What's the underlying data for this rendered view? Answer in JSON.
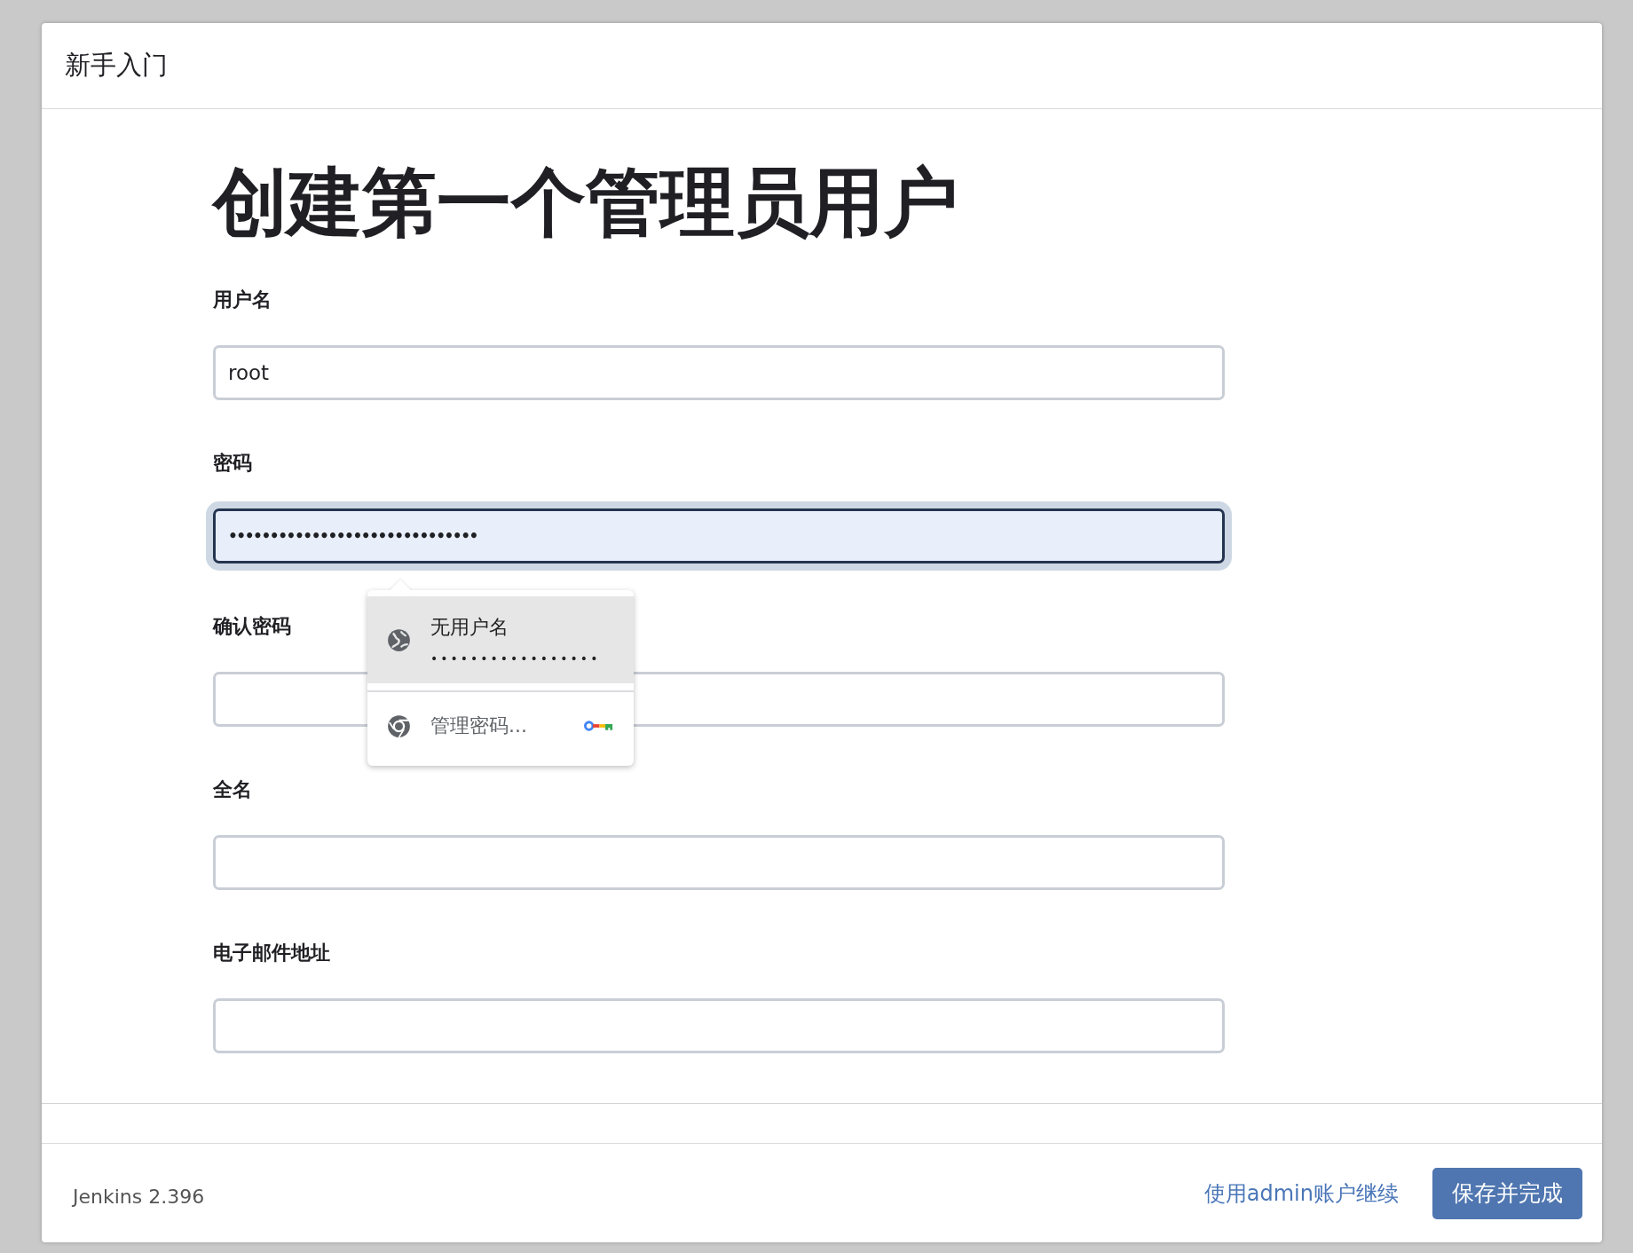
{
  "dialog": {
    "title": "新手入门"
  },
  "heading": "创建第一个管理员用户",
  "fields": [
    {
      "label": "用户名",
      "value": "root",
      "focused": false
    },
    {
      "label": "密码",
      "value": "••••••••••••••••••••••••••••••",
      "focused": true
    },
    {
      "label": "确认密码",
      "focused": false
    },
    {
      "label": "全名",
      "focused": false
    },
    {
      "label": "电子邮件地址",
      "focused": false
    }
  ],
  "autofill_popup": {
    "items": [
      {
        "kind": "credential",
        "title": "无用户名",
        "subtitle": "•••••••••••••••••",
        "selected": true
      },
      {
        "kind": "manage",
        "title": "管理密码...",
        "selected": false
      }
    ]
  },
  "footer": {
    "version": "Jenkins 2.396",
    "link": "使用admin账户继续",
    "button": "保存并完成"
  }
}
